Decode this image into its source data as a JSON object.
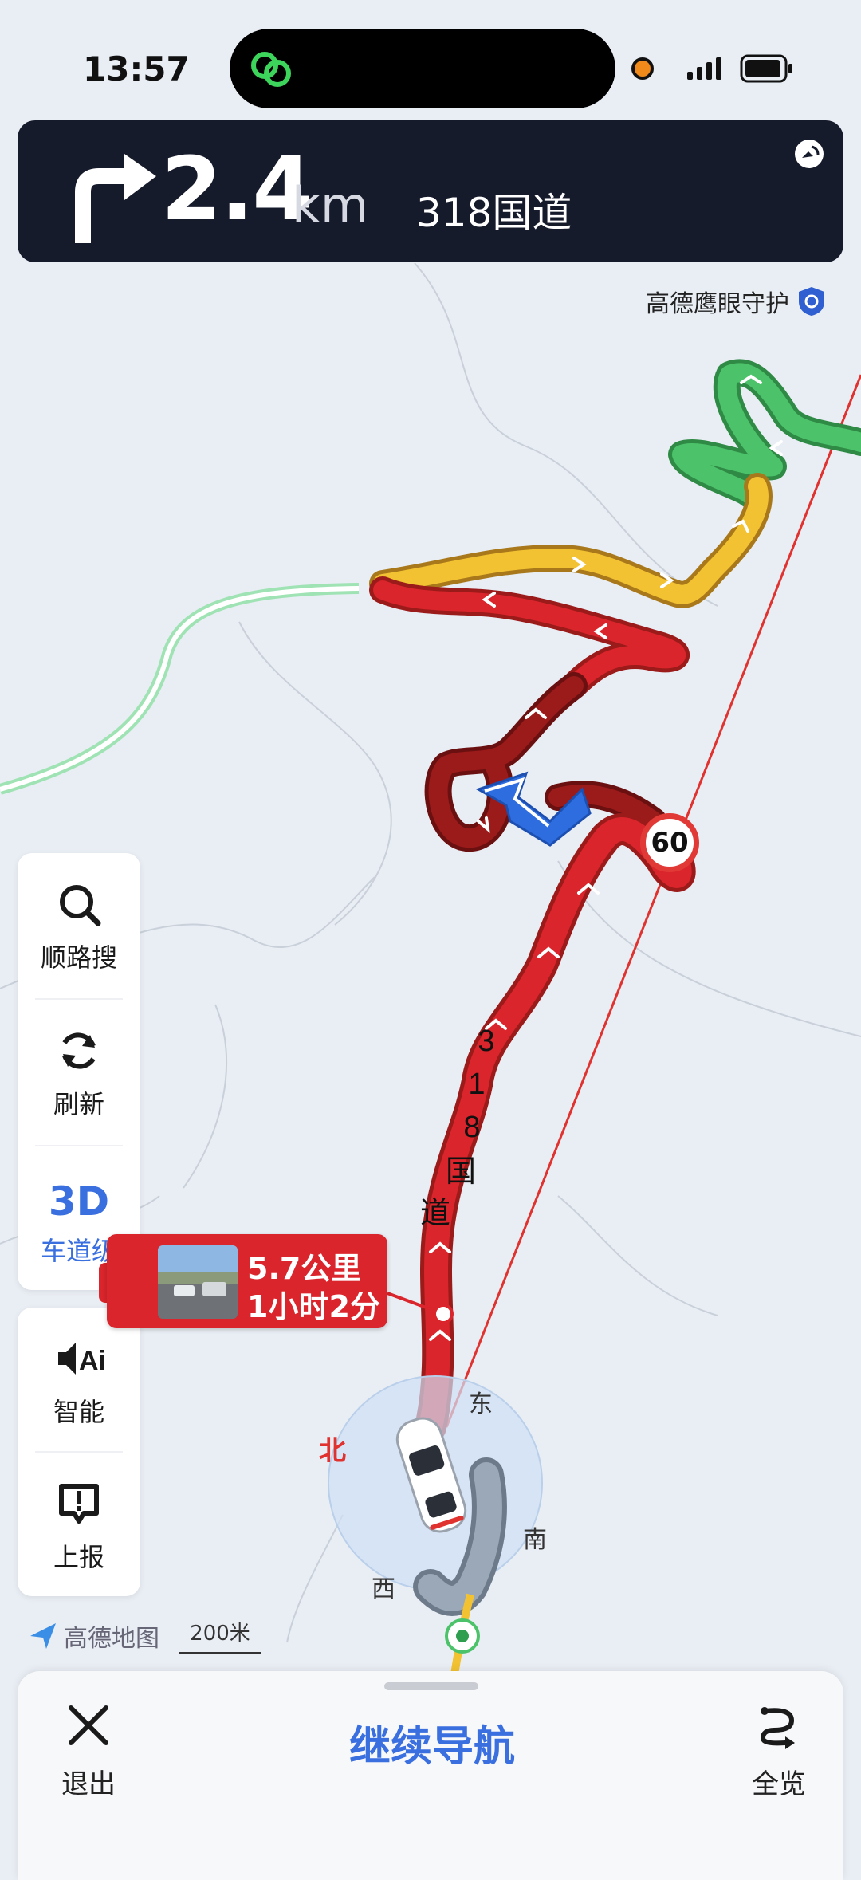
{
  "status_bar": {
    "time": "13:57"
  },
  "navigation": {
    "distance_value": "2.4",
    "distance_unit": "km",
    "road_name": "318国道",
    "turn_direction": "right"
  },
  "eagle_eye": {
    "label": "高德鹰眼守护"
  },
  "map": {
    "road_label_chars": [
      "3",
      "1",
      "8",
      "国",
      "道"
    ],
    "speed_limit": "60",
    "compass": {
      "north": "北",
      "east": "东",
      "south": "南",
      "west": "西"
    },
    "brand": "高德地图",
    "scale": "200米"
  },
  "eta_card": {
    "distance": "5.7公里",
    "time": "1小时2分"
  },
  "side_panel": {
    "search_along": "顺路搜",
    "refresh": "刷新",
    "view_mode": "3D",
    "lane_level": "车道级",
    "smart": "智能",
    "report": "上报"
  },
  "bottom_bar": {
    "exit": "退出",
    "continue_nav": "继续导航",
    "overview": "全览"
  },
  "colors": {
    "accent": "#3a6fe0",
    "congested": "#d9252b",
    "heavy_congested": "#9b1a1a",
    "slow": "#f2c232",
    "clear": "#4cc36a",
    "banner": "#161b2c"
  }
}
